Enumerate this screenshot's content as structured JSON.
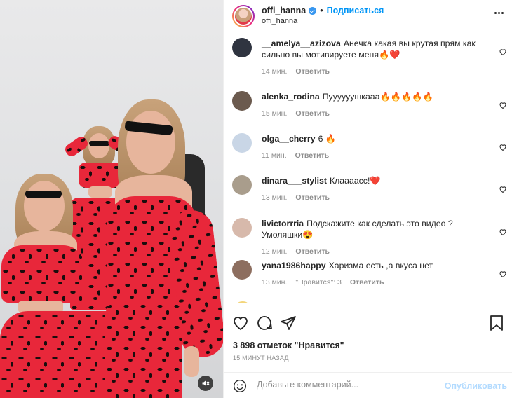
{
  "header": {
    "username": "offi_hanna",
    "separator": "•",
    "follow_label": "Подписаться",
    "subtitle": "offi_hanna"
  },
  "comments": [
    {
      "user": "__amelya__azizova",
      "text": "Анечка какая вы крутая прям как сильно вы мотивируете меня🔥❤️",
      "time": "14 мин.",
      "likes": "",
      "reply": "Ответить",
      "avatar_color": "#2f3440"
    },
    {
      "user": "alenka_rodina",
      "text": "Пуууууушкааа🔥🔥🔥🔥🔥",
      "time": "15 мин.",
      "likes": "",
      "reply": "Ответить",
      "avatar_color": "#6b5a4e"
    },
    {
      "user": "olga__cherry",
      "text": "6 🔥",
      "time": "11 мин.",
      "likes": "",
      "reply": "Ответить",
      "avatar_color": "#c9d6e6"
    },
    {
      "user": "dinara___stylist",
      "text": "Клаааасс!❤️",
      "time": "13 мин.",
      "likes": "",
      "reply": "Ответить",
      "avatar_color": "#a99d8c"
    },
    {
      "user": "livictorrria",
      "text": "Подскажите как сделать это видео ? Умоляшки😍",
      "time": "12 мин.",
      "likes": "",
      "reply": "Ответить",
      "avatar_color": "#d7b9ab"
    },
    {
      "user": "yana1986happy",
      "text": "Харизма есть ,а вкуса нет",
      "time": "13 мин.",
      "likes": "\"Нравится\": 3",
      "reply": "Ответить",
      "avatar_color": "#8d6e5f"
    }
  ],
  "actions": {
    "likes_text": "3 898 отметок \"Нравится\"",
    "posted_ago": "15 МИНУТ НАЗАД"
  },
  "add_comment": {
    "placeholder": "Добавьте комментарий...",
    "publish_label": "Опубликовать"
  },
  "colors": {
    "accent": "#0095f6",
    "publish_disabled": "#b3dbff",
    "muted": "#8e8e8e",
    "text": "#262626"
  },
  "icons": [
    "heart-icon",
    "comment-icon",
    "share-icon",
    "bookmark-icon",
    "emoji-icon",
    "mute-icon",
    "more-icon",
    "verified-icon"
  ]
}
